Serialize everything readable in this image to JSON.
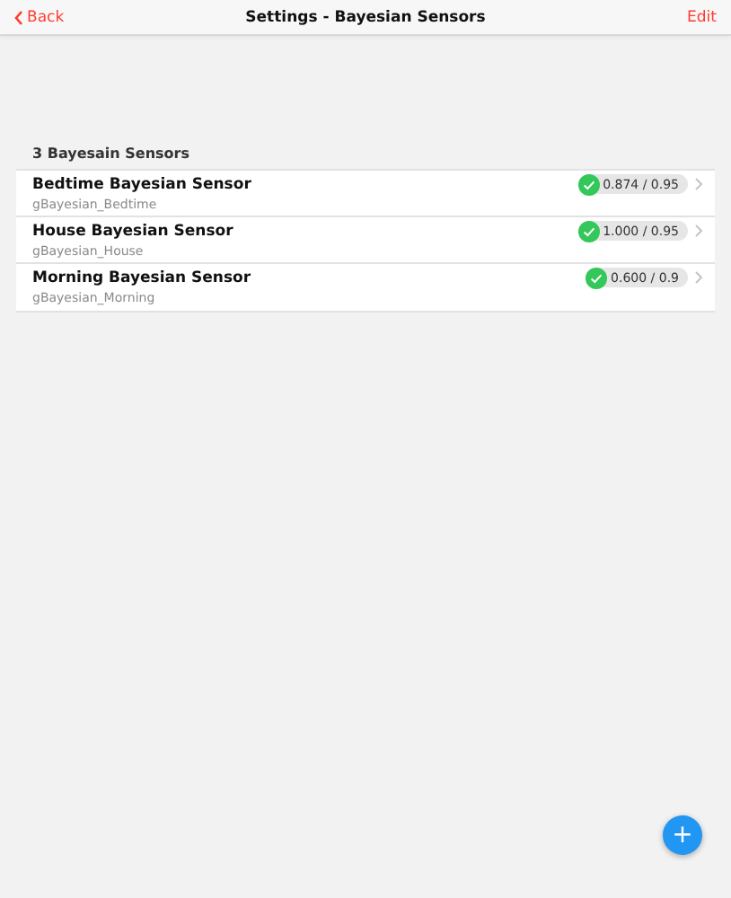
{
  "navbar": {
    "back": "Back",
    "title": "Settings - Bayesian Sensors",
    "action": "Edit"
  },
  "section_title": "3 Bayesain Sensors",
  "sensors": [
    {
      "name": "Bedtime Bayesian Sensor",
      "item": "gBayesian_Bedtime",
      "active": true,
      "reading": "0.874 / 0.95"
    },
    {
      "name": "House Bayesian Sensor",
      "item": "gBayesian_House",
      "active": true,
      "reading": "1.000 / 0.95"
    },
    {
      "name": "Morning Bayesian Sensor",
      "item": "gBayesian_Morning",
      "active": true,
      "reading": "0.600 / 0.9"
    }
  ],
  "fab": "+"
}
